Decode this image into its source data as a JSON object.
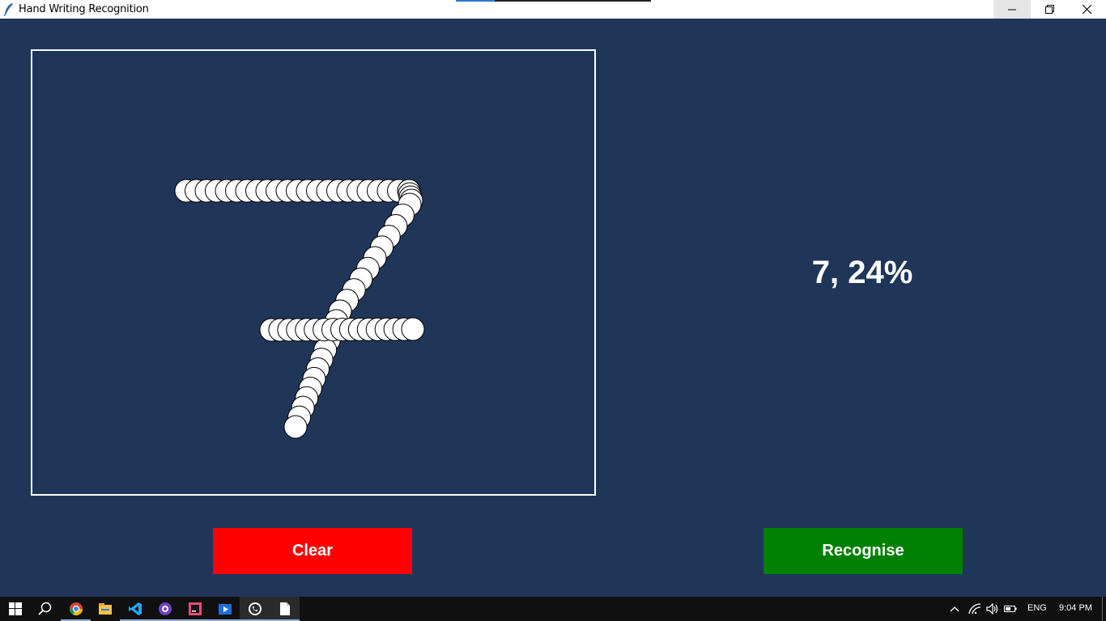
{
  "window": {
    "title": "Hand Writing Recognition"
  },
  "prediction": {
    "text": "7, 24%"
  },
  "buttons": {
    "clear_label": "Clear",
    "recognise_label": "Recognise"
  },
  "colors": {
    "background": "#1f3659",
    "clear_button": "#ff0000",
    "recognise_button": "#008000",
    "stroke_fill": "#ffffff"
  },
  "taskbar": {
    "apps": [
      "start-icon",
      "search-icon",
      "chrome-icon",
      "file-explorer-icon",
      "vscode-icon",
      "github-desktop-icon",
      "kotlin-ide-icon",
      "media-player-icon",
      "whatsapp-icon",
      "notepad-icon"
    ],
    "language": "ENG",
    "time": "9:04 PM"
  }
}
